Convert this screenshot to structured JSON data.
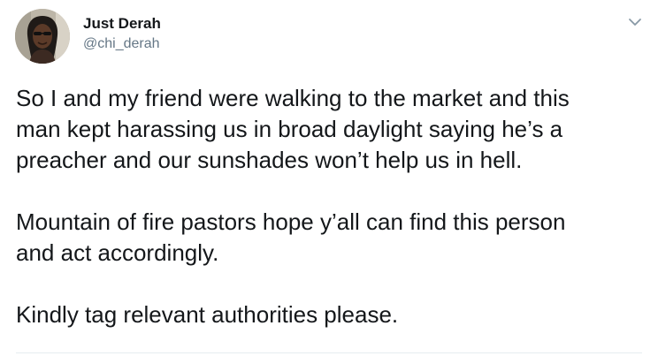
{
  "tweet": {
    "author": {
      "display_name": "Just Derah",
      "handle": "@chi_derah"
    },
    "text_lines": [
      "So I and my friend were walking to the market and this",
      "man kept harassing us in broad daylight saying he’s a",
      "preacher and our sunshades won’t help us in hell.",
      "",
      "Mountain of fire pastors hope y’all can find this person",
      "and act accordingly.",
      "",
      "Kindly tag relevant authorities please."
    ]
  },
  "icons": {
    "menu": "chevron-down-icon",
    "avatar": "avatar-photo"
  },
  "colors": {
    "text": "#14171a",
    "secondary": "#657786",
    "divider": "#e6ecf0"
  }
}
